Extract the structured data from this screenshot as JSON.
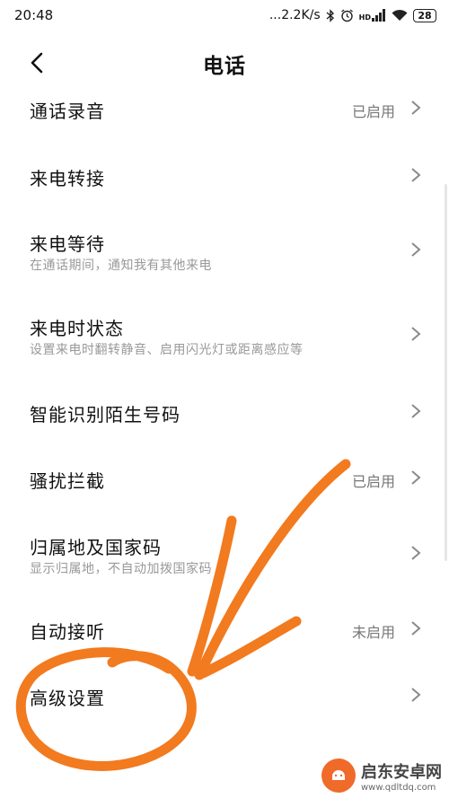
{
  "status_bar": {
    "time": "20:48",
    "network_speed": "...2.2K/s",
    "hd_label": "HD",
    "battery": "28",
    "icons": [
      "bluetooth-icon",
      "alarm-icon",
      "signal-icon",
      "wifi-icon",
      "battery-icon"
    ]
  },
  "header": {
    "back_icon": "chevron-left-icon",
    "title": "电话"
  },
  "rows": [
    {
      "title": "通话录音",
      "value": "已启用"
    },
    {
      "title": "来电转接"
    },
    {
      "title": "来电等待",
      "subtitle": "在通话期间，通知我有其他来电"
    },
    {
      "title": "来电时状态",
      "subtitle": "设置来电时翻转静音、启用闪光灯或距离感应等"
    },
    {
      "title": "智能识别陌生号码"
    },
    {
      "title": "骚扰拦截",
      "value": "已启用"
    },
    {
      "title": "归属地及国家码",
      "subtitle": "显示归属地，不自动加拨国家码"
    },
    {
      "title": "自动接听",
      "value": "未启用"
    },
    {
      "title": "高级设置"
    }
  ],
  "annotation": {
    "color": "#f27a1f"
  },
  "watermark": {
    "name": "启东安卓网",
    "url": "www.qdltdq.com",
    "color": "#f06a2a"
  }
}
